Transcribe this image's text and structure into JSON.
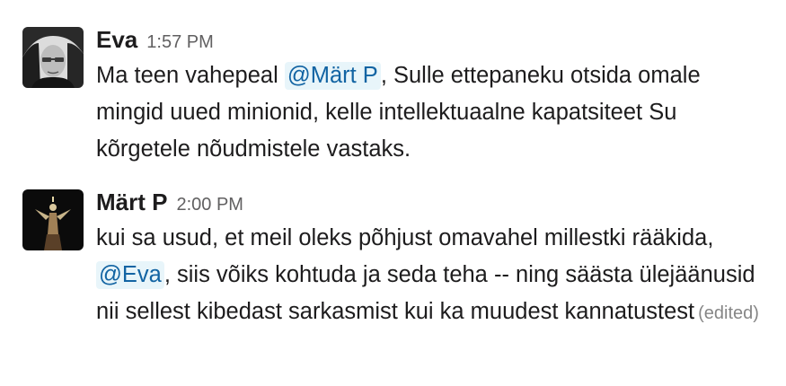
{
  "messages": [
    {
      "author": "Eva",
      "time": "1:57 PM",
      "text_before_mention": "Ma teen vahepeal ",
      "mention": "@Märt P",
      "text_after_mention": ", Sulle ettepaneku otsida omale mingid uued minionid, kelle intellektuaalne kapatsiteet Su kõrgetele nõudmistele vastaks."
    },
    {
      "author": "Märt P",
      "time": "2:00 PM",
      "text_before_mention": "kui sa usud, et meil oleks põhjust omavahel millestki rääkida, ",
      "mention": "@Eva",
      "text_after_mention": ", siis võiks kohtuda ja seda teha -- ning säästa ülejäänusid nii sellest kibedast sarkasmist kui ka muudest kannatustest",
      "edited_label": "(edited)"
    }
  ],
  "colors": {
    "mention_text": "#1264a3",
    "mention_bg": "#e8f5fa",
    "timestamp": "#616061",
    "edited": "#868686"
  }
}
